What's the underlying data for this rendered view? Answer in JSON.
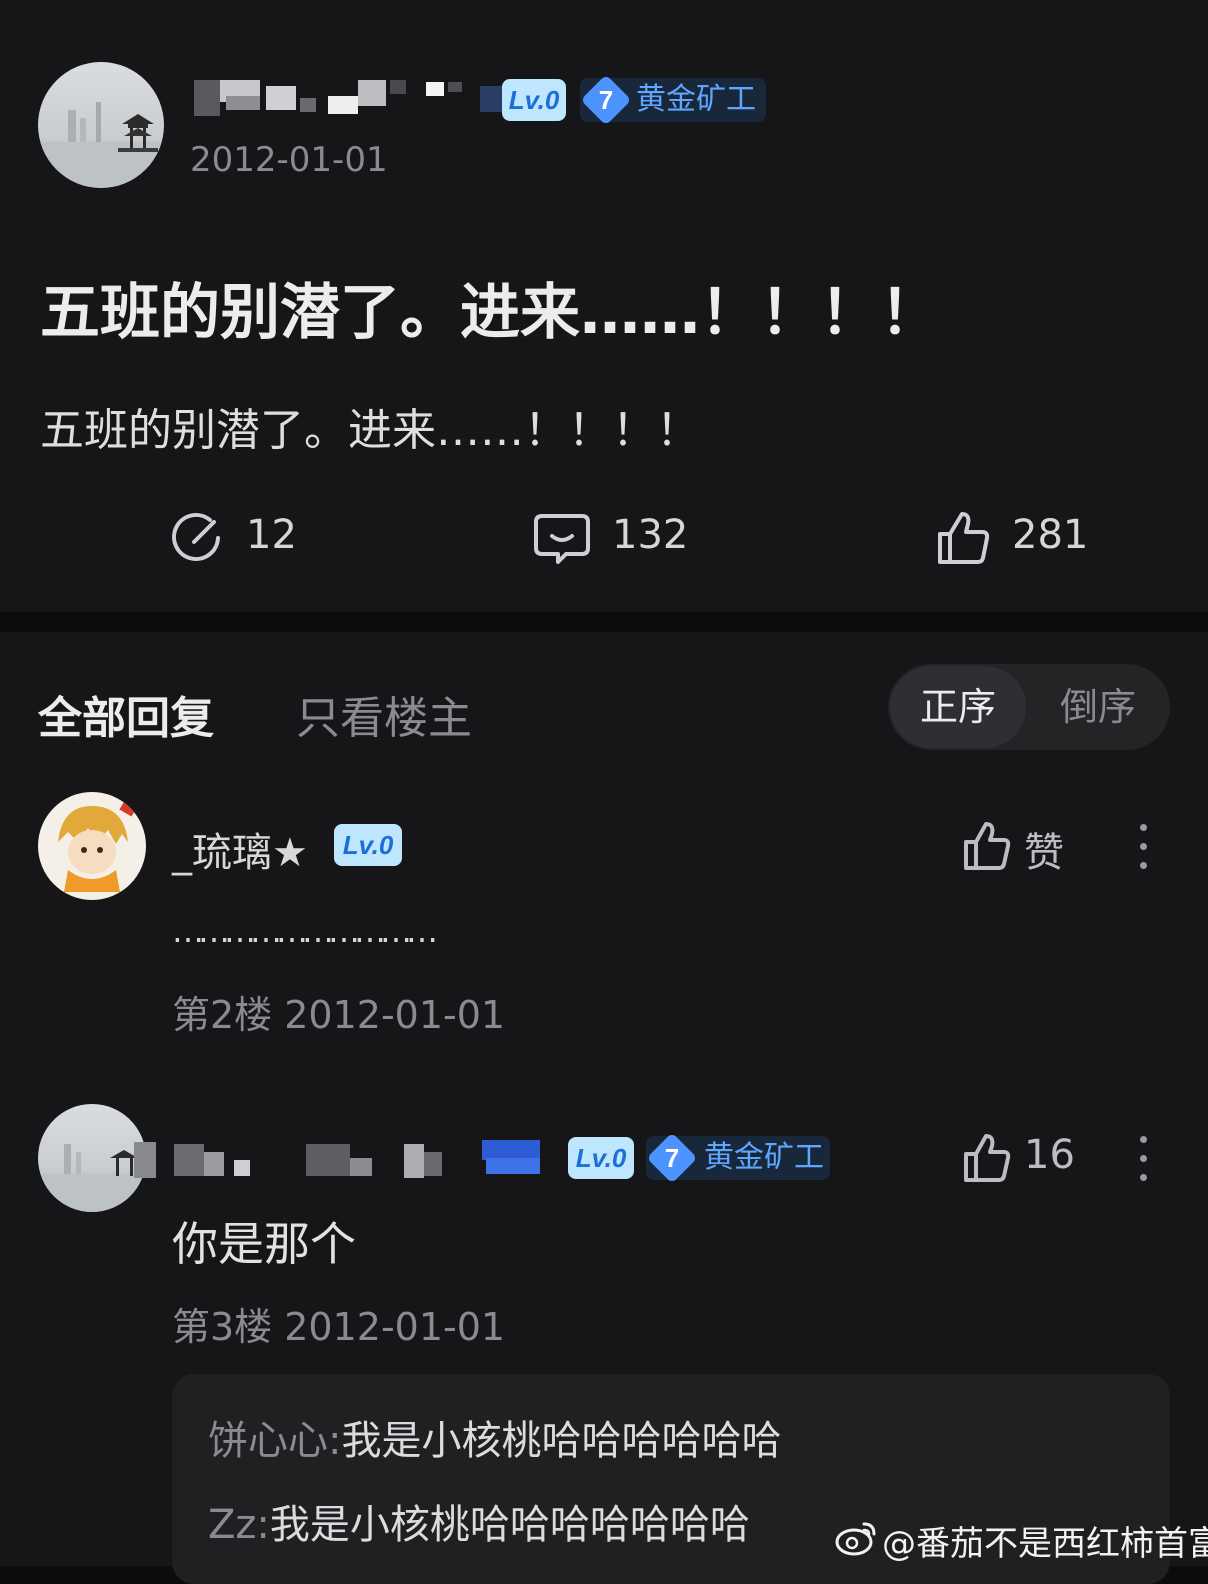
{
  "post": {
    "date": "2012-01-01",
    "title": "五班的别潜了。进来……！！！！",
    "body": "五班的别潜了。进来……！！！！",
    "badge_lv": "Lv.0",
    "tier_number": "7",
    "tier_label": "黄金矿工",
    "actions": {
      "share_count": "12",
      "comment_count": "132",
      "like_count": "281"
    }
  },
  "tabs": {
    "all_replies": "全部回复",
    "op_only": "只看楼主",
    "sort_asc": "正序",
    "sort_desc": "倒序"
  },
  "replies": [
    {
      "username": "_琉璃★",
      "badge_lv": "Lv.0",
      "like_label": "赞",
      "content": "…………………………",
      "meta": "第2楼 2012-01-01"
    },
    {
      "badge_lv": "Lv.0",
      "tier_number": "7",
      "tier_label": "黄金矿工",
      "like_count": "16",
      "content": "你是那个",
      "meta": "第3楼 2012-01-01",
      "sub_replies": [
        {
          "name": "饼心心",
          "sep": ":",
          "text": "我是小核桃哈哈哈哈哈哈"
        },
        {
          "name": "Zz",
          "sep": ":",
          "text": "我是小核桃哈哈哈哈哈哈哈"
        }
      ]
    }
  ],
  "watermark": "@番茄不是西红柿首富"
}
